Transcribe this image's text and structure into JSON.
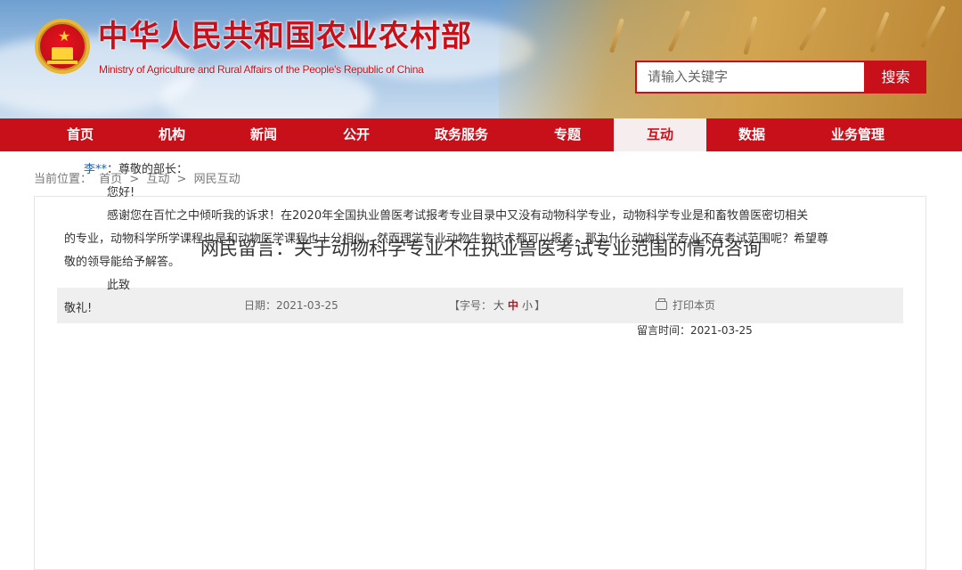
{
  "site": {
    "title_cn": "中华人民共和国农业农村部",
    "title_en": "Ministry of Agriculture and Rural Affairs of the People's Republic of China"
  },
  "search": {
    "placeholder": "请输入关键字",
    "button": "搜索"
  },
  "nav": {
    "items": [
      "首页",
      "机构",
      "新闻",
      "公开",
      "政务服务",
      "专题",
      "互动",
      "数据",
      "业务管理"
    ],
    "active": "互动"
  },
  "breadcrumb": {
    "prefix": "当前位置：",
    "items": [
      "首页",
      ">",
      "互动",
      ">",
      "网民互动"
    ]
  },
  "article": {
    "title": "网民留言：关于动物科学专业不在执业兽医考试专业范围的情况咨询",
    "date_label": "日期：2021-03-25",
    "font_open": "【字号：",
    "font_large": "大",
    "font_medium": "中",
    "font_small": "小",
    "font_close": "】",
    "print_label": "打印本页",
    "sender": "李**",
    "salutation": "：尊敬的部长：",
    "greeting": "您好!",
    "body_first": "感谢您在百忙之中倾听我的诉求！在2020年全国执业兽医考试报考专业目录中又没有动物科学专业，动物科学专业是和畜牧兽医密切相关",
    "body_rest": "的专业，动物科学所学课程也是和动物医学课程也十分相似，然而理学专业动物生物技术都可以报考，那为什么动物科学专业不在考试范围呢？希望尊敬的领导能给予解答。",
    "closing": "此致",
    "regards": "敬礼!",
    "time_label": "留言时间：2021-03-25"
  },
  "colors": {
    "brand_red": "#c8101a",
    "nav_active_bg": "#f6eeee",
    "sender_blue": "#1f5fa9"
  }
}
